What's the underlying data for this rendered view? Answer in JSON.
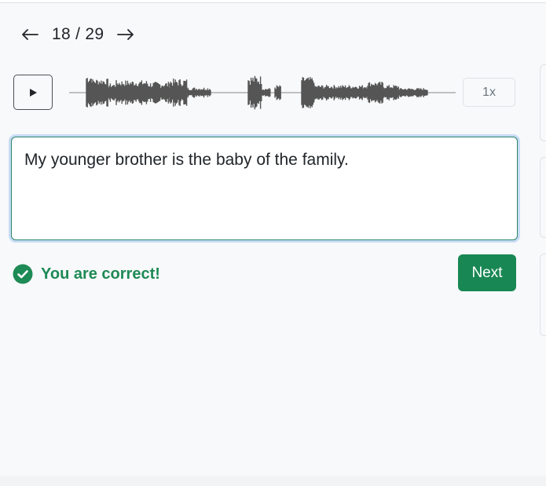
{
  "navigation": {
    "prev_icon": "arrow-left-icon",
    "counter": "18 / 29",
    "current": 18,
    "total": 29,
    "next_icon": "arrow-right-icon"
  },
  "audio": {
    "play_icon": "play-icon",
    "speed_label": "1x",
    "waveform_color": "#555555"
  },
  "answer": {
    "value": "My younger brother is the baby of the family."
  },
  "feedback": {
    "icon": "check-circle-icon",
    "message": "You are correct!",
    "color": "#1e8a55"
  },
  "actions": {
    "next_label": "Next",
    "next_color": "#198754"
  }
}
